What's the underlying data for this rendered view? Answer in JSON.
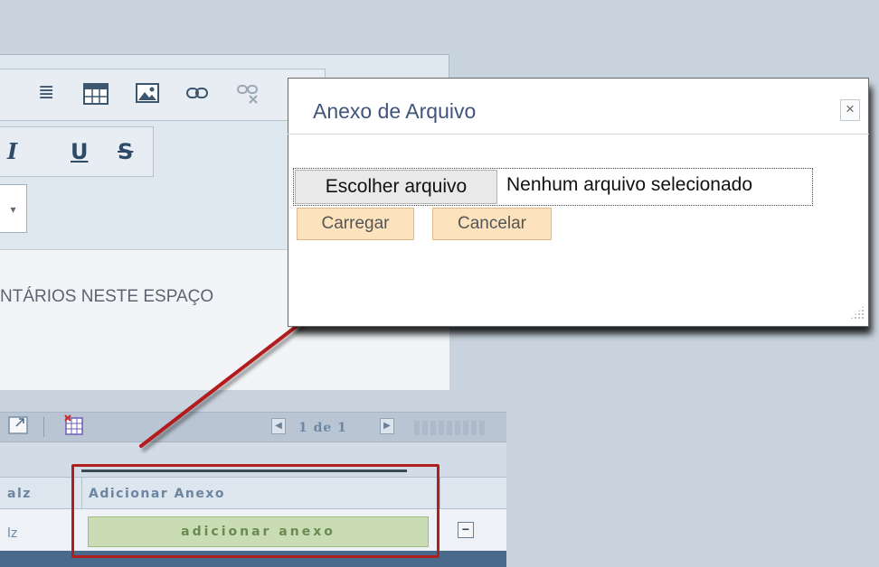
{
  "editor": {
    "content_text": "NTÁRIOS NESTE ESPAÇO"
  },
  "pager": {
    "text": "1 de 1"
  },
  "grid": {
    "header_col1": "alz",
    "header_col2": "Adicionar Anexo",
    "row_col1": "lz",
    "add_button": "adicionar anexo",
    "minus_symbol": "−"
  },
  "dialog": {
    "title": "Anexo de Arquivo",
    "close_symbol": "×",
    "choose_file_label": "Escolher arquivo",
    "file_status": "Nenhum arquivo selecionado",
    "upload_label": "Carregar",
    "cancel_label": "Cancelar"
  },
  "colors": {
    "highlight": "#b01e1e",
    "arrow": "#b31c1c",
    "dialog_title": "#40557a",
    "button_orange": "#fce3be",
    "add_button_green": "#c9dcb4"
  },
  "icons": [
    "align-justify-icon",
    "table-icon",
    "image-icon",
    "link-icon",
    "unlink-icon",
    "bold-icon",
    "italic-icon",
    "underline-icon",
    "strikethrough-icon",
    "export-icon",
    "excel-icon",
    "first-page-icon",
    "last-page-icon",
    "close-icon"
  ]
}
